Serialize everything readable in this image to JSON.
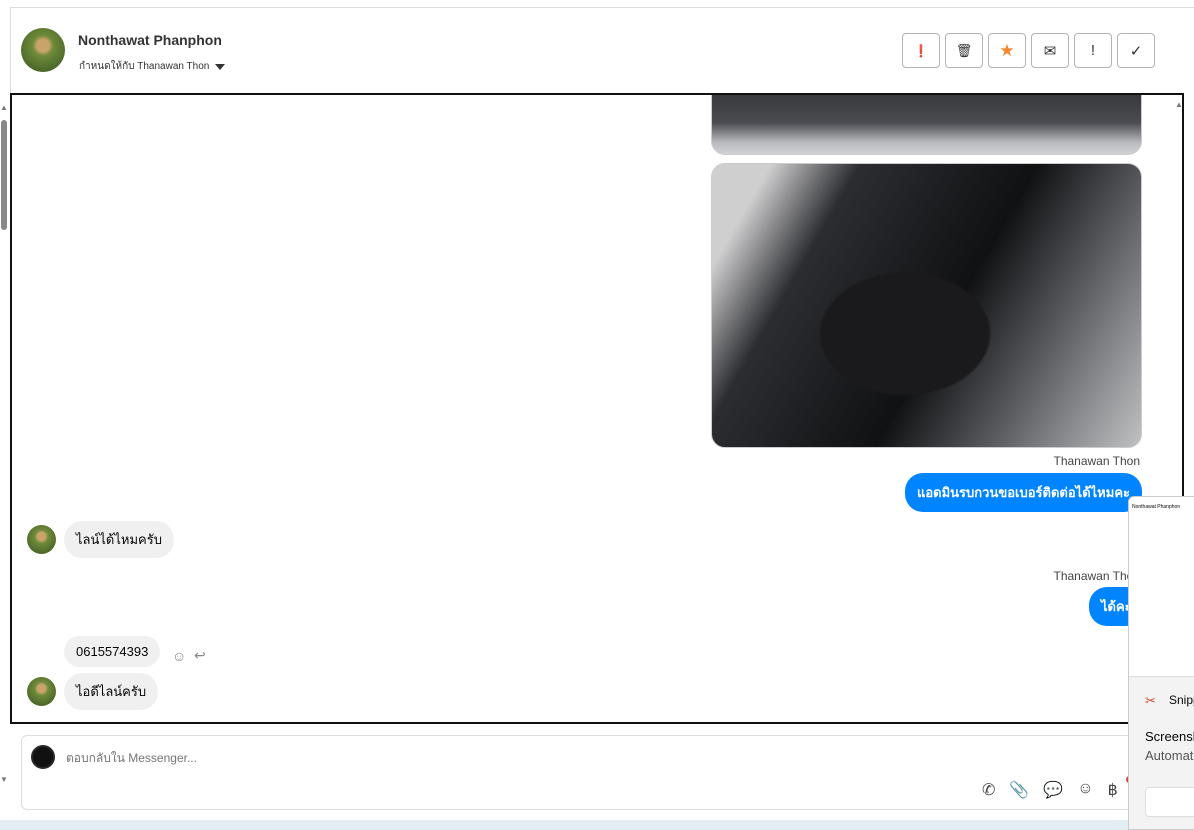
{
  "header": {
    "name": "Nonthawat Phanphon",
    "assigned": "กำหนดให้กับ Thanawan Thon"
  },
  "toolbar": [
    {
      "icon": "alert-circle-icon",
      "glyph": "❗"
    },
    {
      "icon": "trash-icon",
      "glyph": "🗑"
    },
    {
      "icon": "star-icon",
      "glyph": "★",
      "color": "#f5862a"
    },
    {
      "icon": "mail-open-icon",
      "glyph": "✉"
    },
    {
      "icon": "exclamation-icon",
      "glyph": "!"
    },
    {
      "icon": "check-icon",
      "glyph": "✓"
    }
  ],
  "messages": [
    {
      "sender": "Thanawan Thon",
      "text": "แอดมินรบกวนขอเบอร์ติดต่อได้ไหมคะ"
    },
    {
      "text": "ไลน์ได้ไหมครับ"
    },
    {
      "sender": "Thanawan Thon",
      "text": "ได้คะ"
    },
    {
      "text": "0615574393"
    },
    {
      "text": "ไอดีไลน์ครับ"
    }
  ],
  "composer": {
    "placeholder": "ตอบกลับใน Messenger...",
    "icons": [
      "phone-add-icon",
      "paperclip-icon",
      "chat-bubble-icon",
      "emoji-icon",
      "baht-icon"
    ]
  },
  "notification": {
    "app": "Snipping Tool",
    "title": "Screenshot copied",
    "subtitle": "Automatically saved"
  },
  "colors": {
    "accent": "#0084ff",
    "star": "#f5862a"
  }
}
